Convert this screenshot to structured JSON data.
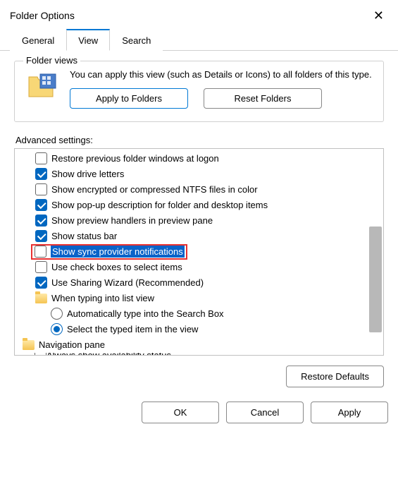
{
  "title": "Folder Options",
  "tabs": {
    "general": "General",
    "view": "View",
    "search": "Search"
  },
  "folderViews": {
    "legend": "Folder views",
    "text": "You can apply this view (such as Details or Icons) to all folders of this type.",
    "applyBtn": "Apply to Folders",
    "resetBtn": "Reset Folders"
  },
  "advLabel": "Advanced settings:",
  "tree": {
    "restorePrev": "Restore previous folder windows at logon",
    "showDrive": "Show drive letters",
    "showEnc": "Show encrypted or compressed NTFS files in color",
    "showPopup": "Show pop-up description for folder and desktop items",
    "showPreview": "Show preview handlers in preview pane",
    "showStatus": "Show status bar",
    "showSync": "Show sync provider notifications",
    "useCheck": "Use check boxes to select items",
    "useSharing": "Use Sharing Wizard (Recommended)",
    "whenTyping": "When typing into list view",
    "autoType": "Automatically type into the Search Box",
    "selectTyped": "Select the typed item in the view",
    "navPane": "Navigation pane",
    "alwaysShow": "Always show availability status"
  },
  "restoreBtn": "Restore Defaults",
  "footer": {
    "ok": "OK",
    "cancel": "Cancel",
    "apply": "Apply"
  }
}
